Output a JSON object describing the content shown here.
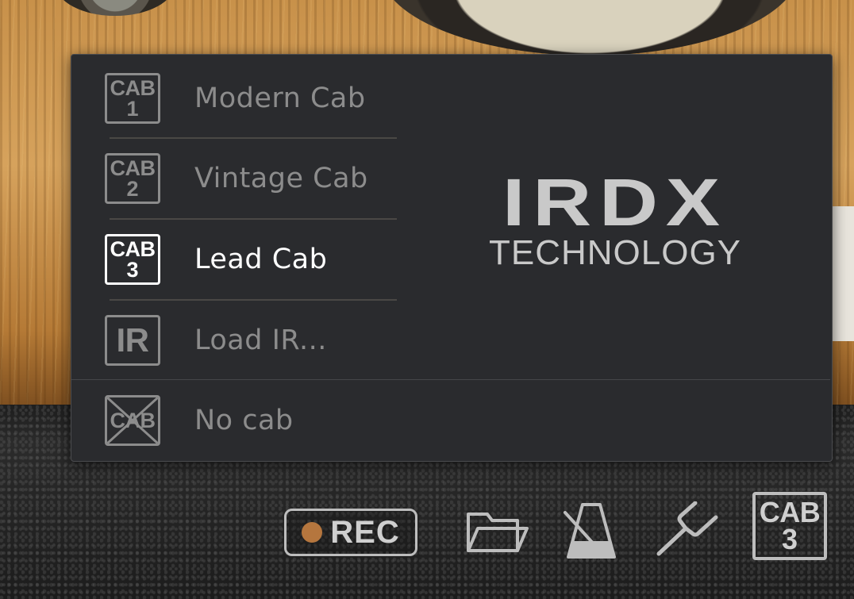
{
  "menu": {
    "items": [
      {
        "badge_top": "CAB",
        "badge_bottom": "1",
        "label": "Modern Cab",
        "selected": false
      },
      {
        "badge_top": "CAB",
        "badge_bottom": "2",
        "label": "Vintage Cab",
        "selected": false
      },
      {
        "badge_top": "CAB",
        "badge_bottom": "3",
        "label": "Lead Cab",
        "selected": true
      },
      {
        "badge_top": "IR",
        "label": "Load IR..."
      },
      {
        "badge_top": "CAB",
        "label": "No cab"
      }
    ]
  },
  "brand": {
    "word": "IRDX",
    "sub": "TECHNOLOGY"
  },
  "toolbar": {
    "rec_label": "REC",
    "cab_top": "CAB",
    "cab_bottom": "3"
  },
  "colors": {
    "menu_bg": "#2a2b2e",
    "text_dim": "#8c8c8c",
    "text_selected": "#ffffff",
    "rec_dot": "#b5763e"
  },
  "icons": [
    "folder-icon",
    "metronome-icon",
    "tuning-fork-icon",
    "no-cab-icon"
  ]
}
